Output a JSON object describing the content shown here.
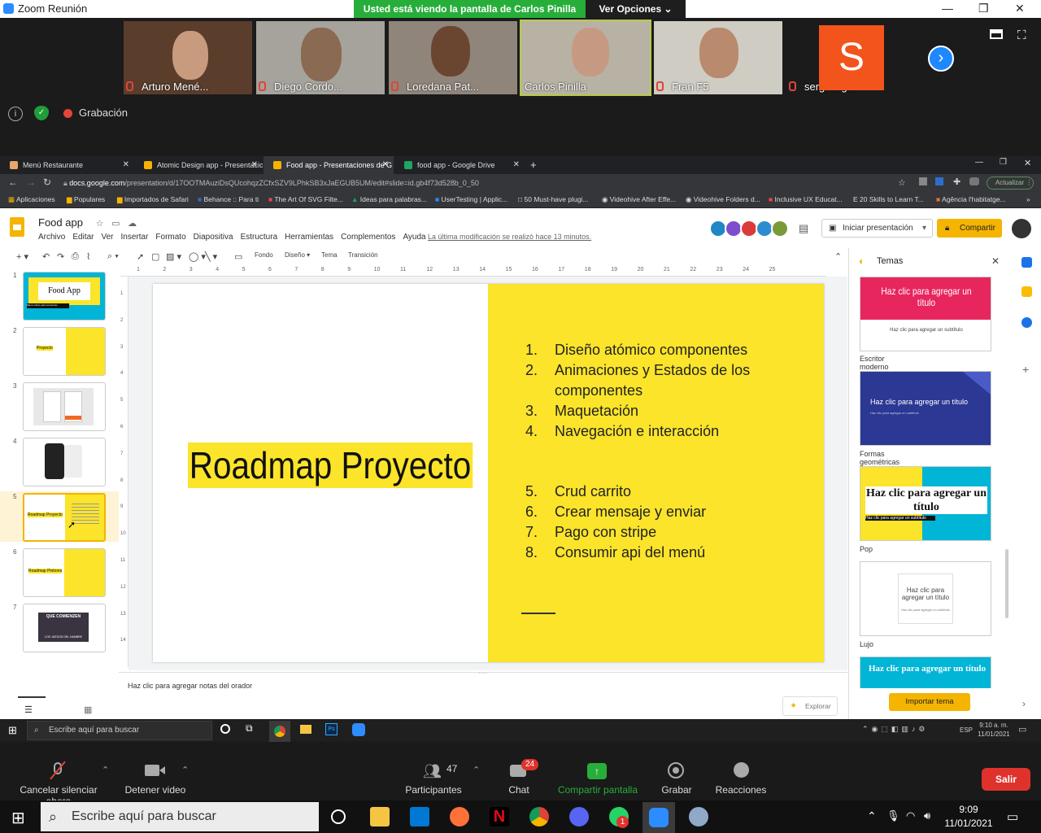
{
  "zoom": {
    "window_title": "Zoom Reunión",
    "share_banner": "Usted está viendo la pantalla de Carlos Pinilla",
    "view_options": "Ver Opciones",
    "participants": [
      {
        "name": "Arturo Mené...",
        "muted": true
      },
      {
        "name": "Diego Cordo...",
        "muted": true
      },
      {
        "name": "Loredana Pat...",
        "muted": true
      },
      {
        "name": "Carlos Pinilla",
        "muted": false
      },
      {
        "name": "Fran F5",
        "muted": true
      },
      {
        "name": "sergi virgili",
        "muted": true,
        "initial": "S"
      }
    ],
    "recording_label": "Grabación",
    "bottom": {
      "mute": "Cancelar silenciar ahora",
      "video": "Detener video",
      "participants": "Participantes",
      "participants_count": "47",
      "chat": "Chat",
      "chat_badge": "24",
      "share": "Compartir pantalla",
      "record": "Grabar",
      "reactions": "Reacciones",
      "leave": "Salir"
    }
  },
  "browser": {
    "tabs": [
      {
        "title": "Menú Restaurante"
      },
      {
        "title": "Atomic Design app - Presentacio"
      },
      {
        "title": "Food app - Presentaciones de G"
      },
      {
        "title": "food app - Google Drive"
      }
    ],
    "url_domain": "docs.google.com",
    "url_path": "/presentation/d/17OOTMAuziDsQUcohqzZCfxSZV9LPhkSB3xJaEGUB5UM/edit#slide=id.gb4f73d528b_0_50",
    "update_button": "Actualizar",
    "bookmarks": [
      "Aplicaciones",
      "Populares",
      "Importados de Safari",
      "Behance :: Para ti",
      "The Art Of SVG Filte...",
      "Ideas para palabras...",
      "UserTesting | Applic...",
      "50 Must-have plugi...",
      "Videohive After Effe...",
      "Videohive Folders d...",
      "Inclusive UX Educat...",
      "20 Skills to Learn T...",
      "Agência l'habitatge..."
    ]
  },
  "slides": {
    "doc_title": "Food app",
    "menus": [
      "Archivo",
      "Editar",
      "Ver",
      "Insertar",
      "Formato",
      "Diapositiva",
      "Estructura",
      "Herramientas",
      "Complementos",
      "Ayuda"
    ],
    "last_modified": "La última modificación se realizó hace 13 minutos.",
    "present_button": "Iniciar presentación",
    "share_button": "Compartir",
    "toolbar": {
      "background": "Fondo",
      "layout": "Diseño",
      "theme": "Tema",
      "transition": "Transición"
    },
    "ruler_top": [
      "1",
      "2",
      "3",
      "4",
      "5",
      "6",
      "7",
      "8",
      "9",
      "10",
      "11",
      "12",
      "13",
      "14",
      "15",
      "16",
      "17",
      "18",
      "19",
      "20",
      "21",
      "22",
      "23",
      "24",
      "25"
    ],
    "ruler_left": [
      "1",
      "2",
      "3",
      "4",
      "5",
      "6",
      "7",
      "8",
      "9",
      "10",
      "11",
      "12",
      "13",
      "14"
    ],
    "thumbnails": [
      {
        "num": "1",
        "title": "Food App",
        "sub": "Menú online para comercios"
      },
      {
        "num": "2",
        "title": "Proyecto"
      },
      {
        "num": "3"
      },
      {
        "num": "4"
      },
      {
        "num": "5",
        "title": "Roadmap Proyecto"
      },
      {
        "num": "6",
        "title": "Roadmap Pintores"
      },
      {
        "num": "7",
        "title": "QUE COMIENZEN",
        "sub": "LOS JUEGOS DEL HAMBRE"
      }
    ],
    "current_slide": {
      "title": "Roadmap Proyecto",
      "list": [
        {
          "n": "1.",
          "text": "Diseño atómico componentes"
        },
        {
          "n": "2.",
          "text": "Animaciones y Estados de los componentes"
        },
        {
          "n": "3.",
          "text": "Maquetación"
        },
        {
          "n": "4.",
          "text": "Navegación e interacción"
        },
        {
          "n": "5.",
          "text": "Crud carrito"
        },
        {
          "n": "6.",
          "text": "Crear mensaje y enviar"
        },
        {
          "n": "7.",
          "text": "Pago con stripe"
        },
        {
          "n": "8.",
          "text": "Consumir api del menú"
        }
      ]
    },
    "notes_placeholder": "Haz clic para agregar notas del orador",
    "explore_button": "Explorar",
    "themes_panel": {
      "title": "Temas",
      "theme_cards": [
        {
          "title": "Haz clic para agregar un título",
          "subtitle": "Haz clic para agregar un subtítulo",
          "label": "Escritor moderno",
          "bg": "#ffffff",
          "accent": "#e8265e"
        },
        {
          "title": "Haz clic para agregar un título",
          "subtitle": "Haz clic para agregar un subtítulo",
          "label": "Formas geométricas",
          "bg": "#2b3894",
          "accent": "#2b3894"
        },
        {
          "title": "Haz clic para agregar un título",
          "subtitle": "Haz clic para agregar un subtítulo",
          "label": "Pop",
          "bg": "#fbe42a",
          "accent": "#00b5d6"
        },
        {
          "title": "Haz clic para agregar un título",
          "subtitle": "Haz clic para agregar un subtítulo",
          "label": "Lujo",
          "bg": "#ffffff",
          "accent": "#cccccc"
        },
        {
          "title": "Haz clic para agregar un título",
          "label": "",
          "bg": "#00b5d6",
          "accent": "#00b5d6"
        }
      ],
      "import_button": "Importar tema"
    }
  },
  "inner_taskbar": {
    "search": "Escribe aquí para buscar",
    "lang": "ESP",
    "time": "9:10 a. m.",
    "date": "11/01/2021"
  },
  "outer_taskbar": {
    "search": "Escribe aquí para buscar",
    "time": "9:09",
    "date": "11/01/2021",
    "whatsapp_badge": "1"
  },
  "colors": {
    "slide_yellow": "#fbe42a",
    "zoom_green": "#27ae3a",
    "zoom_blue": "#2d8cff",
    "leave_red": "#e0322c",
    "slides_yellow": "#f4b400"
  }
}
